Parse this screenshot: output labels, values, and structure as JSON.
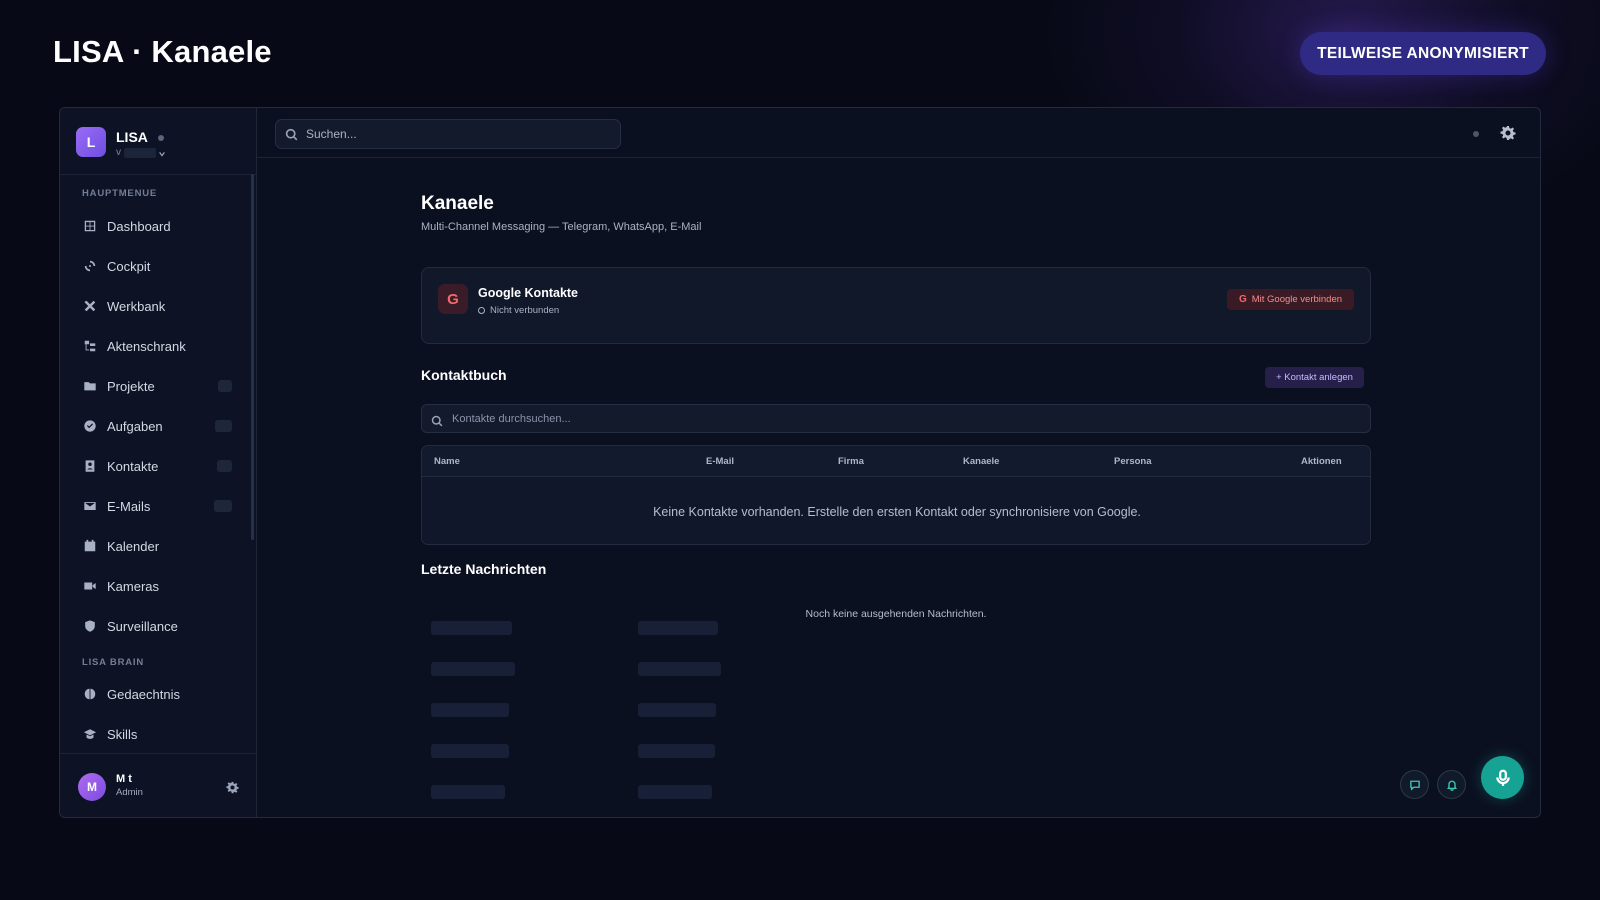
{
  "header": {
    "title": "LISA · Kanaele",
    "anonymization_badge": "TEILWEISE ANONYMISIERT"
  },
  "sidebar": {
    "brand": {
      "logo_letter": "L",
      "name": "LISA",
      "subtitle": "v"
    },
    "sections": [
      {
        "label": "HAUPTMENUE"
      },
      {
        "label": "LISA BRAIN"
      }
    ],
    "items": [
      {
        "label": "Dashboard",
        "icon": "dashboard-icon"
      },
      {
        "label": "Cockpit",
        "icon": "cockpit-icon"
      },
      {
        "label": "Werkbank",
        "icon": "tools-icon"
      },
      {
        "label": "Aktenschrank",
        "icon": "folder-tree-icon"
      },
      {
        "label": "Projekte",
        "icon": "folder-icon"
      },
      {
        "label": "Aufgaben",
        "icon": "check-circle-icon"
      },
      {
        "label": "Kontakte",
        "icon": "contacts-icon"
      },
      {
        "label": "E-Mails",
        "icon": "mail-icon"
      },
      {
        "label": "Kalender",
        "icon": "calendar-icon"
      },
      {
        "label": "Kameras",
        "icon": "camera-icon"
      },
      {
        "label": "Surveillance",
        "icon": "shield-icon"
      },
      {
        "label": "Gedaechtnis",
        "icon": "brain-icon"
      },
      {
        "label": "Skills",
        "icon": "graduation-cap-icon"
      }
    ],
    "user": {
      "initial": "M",
      "name": "M    t",
      "role": "Admin"
    }
  },
  "topbar": {
    "search_placeholder": "Suchen..."
  },
  "main": {
    "title": "Kanaele",
    "subtitle": "Multi-Channel Messaging — Telegram, WhatsApp, E-Mail",
    "google": {
      "icon_letter": "G",
      "title": "Google Kontakte",
      "status": "Nicht verbunden",
      "connect_label": "Mit Google verbinden"
    },
    "contacts": {
      "title": "Kontaktbuch",
      "add_label": "+ Kontakt anlegen",
      "search_placeholder": "Kontakte durchsuchen...",
      "columns": [
        "Name",
        "E-Mail",
        "Firma",
        "Kanaele",
        "Persona",
        "Aktionen"
      ],
      "empty_message": "Keine Kontakte vorhanden. Erstelle den ersten Kontakt oder synchronisiere von Google."
    },
    "messages": {
      "title": "Letzte Nachrichten",
      "empty_message": "Noch keine ausgehenden Nachrichten."
    }
  },
  "colors": {
    "background": "#070a16",
    "accent_purple": "#2f2a84",
    "mic_button": "#16a394",
    "google_red": "#f06a6a"
  }
}
